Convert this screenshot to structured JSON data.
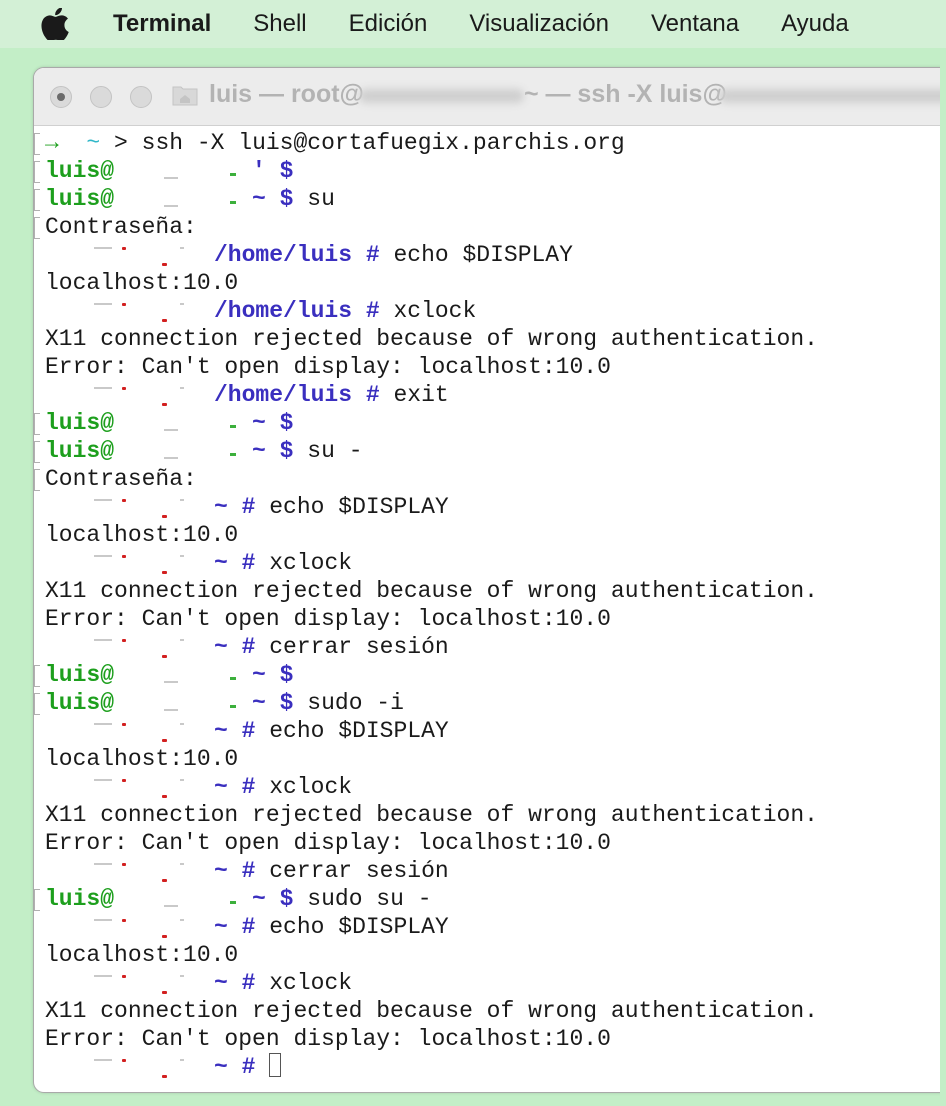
{
  "menubar": {
    "apple": "apple-logo-icon",
    "app": "Terminal",
    "items": [
      "Shell",
      "Edición",
      "Visualización",
      "Ventana",
      "Ayuda"
    ]
  },
  "window": {
    "title_prefix": "luis — root@",
    "title_middle": "~ — ssh -X luis@",
    "colors": {
      "green": "#1d9f1d",
      "blue": "#3a2fbf",
      "cyan": "#2fb7c8",
      "red": "#d22020"
    }
  },
  "terminal": {
    "lines": [
      {
        "type": "local",
        "arrow": "→",
        "tilde": "~",
        "cmd": "> ssh -X luis@cortafuegix.parchis.org"
      },
      {
        "type": "user",
        "user": "luis@",
        "dir": "'",
        "sigil": "$",
        "cmd": ""
      },
      {
        "type": "user",
        "user": "luis@",
        "dir": "~",
        "sigil": "$",
        "cmd": "su"
      },
      {
        "type": "out",
        "text": "Contraseña:",
        "marked": true
      },
      {
        "type": "root",
        "dir": "/home/luis",
        "sigil": "#",
        "cmd": "echo $DISPLAY"
      },
      {
        "type": "out",
        "text": "localhost:10.0"
      },
      {
        "type": "root",
        "dir": "/home/luis",
        "sigil": "#",
        "cmd": "xclock"
      },
      {
        "type": "out",
        "text": "X11 connection rejected because of wrong authentication."
      },
      {
        "type": "out",
        "text": "Error: Can't open display: localhost:10.0"
      },
      {
        "type": "root",
        "dir": "/home/luis",
        "sigil": "#",
        "cmd": "exit"
      },
      {
        "type": "user",
        "user": "luis@",
        "dir": "~",
        "sigil": "$",
        "cmd": ""
      },
      {
        "type": "user",
        "user": "luis@",
        "dir": "~",
        "sigil": "$",
        "cmd": "su -"
      },
      {
        "type": "out",
        "text": "Contraseña:",
        "marked": true
      },
      {
        "type": "root",
        "dir": "~",
        "sigil": "#",
        "cmd": "echo $DISPLAY"
      },
      {
        "type": "out",
        "text": "localhost:10.0"
      },
      {
        "type": "root",
        "dir": "~",
        "sigil": "#",
        "cmd": "xclock"
      },
      {
        "type": "out",
        "text": "X11 connection rejected because of wrong authentication."
      },
      {
        "type": "out",
        "text": "Error: Can't open display: localhost:10.0"
      },
      {
        "type": "root",
        "dir": "~",
        "sigil": "#",
        "cmd": "cerrar sesión"
      },
      {
        "type": "user",
        "user": "luis@",
        "dir": "~",
        "sigil": "$",
        "cmd": ""
      },
      {
        "type": "user",
        "user": "luis@",
        "dir": "~",
        "sigil": "$",
        "cmd": "sudo -i"
      },
      {
        "type": "root",
        "dir": "~",
        "sigil": "#",
        "cmd": "echo $DISPLAY"
      },
      {
        "type": "out",
        "text": "localhost:10.0"
      },
      {
        "type": "root",
        "dir": "~",
        "sigil": "#",
        "cmd": "xclock"
      },
      {
        "type": "out",
        "text": "X11 connection rejected because of wrong authentication."
      },
      {
        "type": "out",
        "text": "Error: Can't open display: localhost:10.0"
      },
      {
        "type": "root",
        "dir": "~",
        "sigil": "#",
        "cmd": "cerrar sesión"
      },
      {
        "type": "user",
        "user": "luis@",
        "dir": "~",
        "sigil": "$",
        "cmd": "sudo su -"
      },
      {
        "type": "root",
        "dir": "~",
        "sigil": "#",
        "cmd": "echo $DISPLAY"
      },
      {
        "type": "out",
        "text": "localhost:10.0"
      },
      {
        "type": "root",
        "dir": "~",
        "sigil": "#",
        "cmd": "xclock"
      },
      {
        "type": "out",
        "text": "X11 connection rejected because of wrong authentication."
      },
      {
        "type": "out",
        "text": "Error: Can't open display: localhost:10.0"
      },
      {
        "type": "root",
        "dir": "~",
        "sigil": "#",
        "cmd": "",
        "cursor": true
      }
    ]
  }
}
